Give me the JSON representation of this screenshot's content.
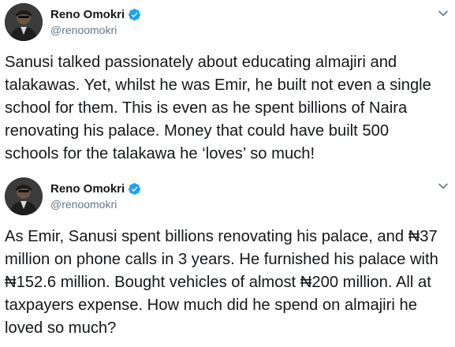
{
  "tweets": [
    {
      "author": {
        "display_name": "Reno Omokri",
        "handle": "@renoomokri",
        "verified": true,
        "avatar_icon": "profile-photo-icon"
      },
      "menu_icon": "chevron-down-icon",
      "text": "Sanusi talked passionately about educating almajiri and talakawas. Yet, whilst he was Emir, he built not even a single school for them. This is even as he spent billions of Naira renovating his palace. Money that could have built 500 schools for the talakawa he ‘loves’ so much!"
    },
    {
      "author": {
        "display_name": "Reno Omokri",
        "handle": "@renoomokri",
        "verified": true,
        "avatar_icon": "profile-photo-icon"
      },
      "menu_icon": "chevron-down-icon",
      "text": "As Emir, Sanusi spent billions renovating his palace, and ₦37 million on phone calls in 3 years. He furnished his palace with ₦152.6 million. Bought vehicles of almost ₦200 million. All at taxpayers expense. How much did he spend on almajiri he loved so much?"
    }
  ],
  "colors": {
    "text": "#14171a",
    "secondary_text": "#657786",
    "verified_badge": "#1da1f2",
    "background": "#ffffff"
  }
}
